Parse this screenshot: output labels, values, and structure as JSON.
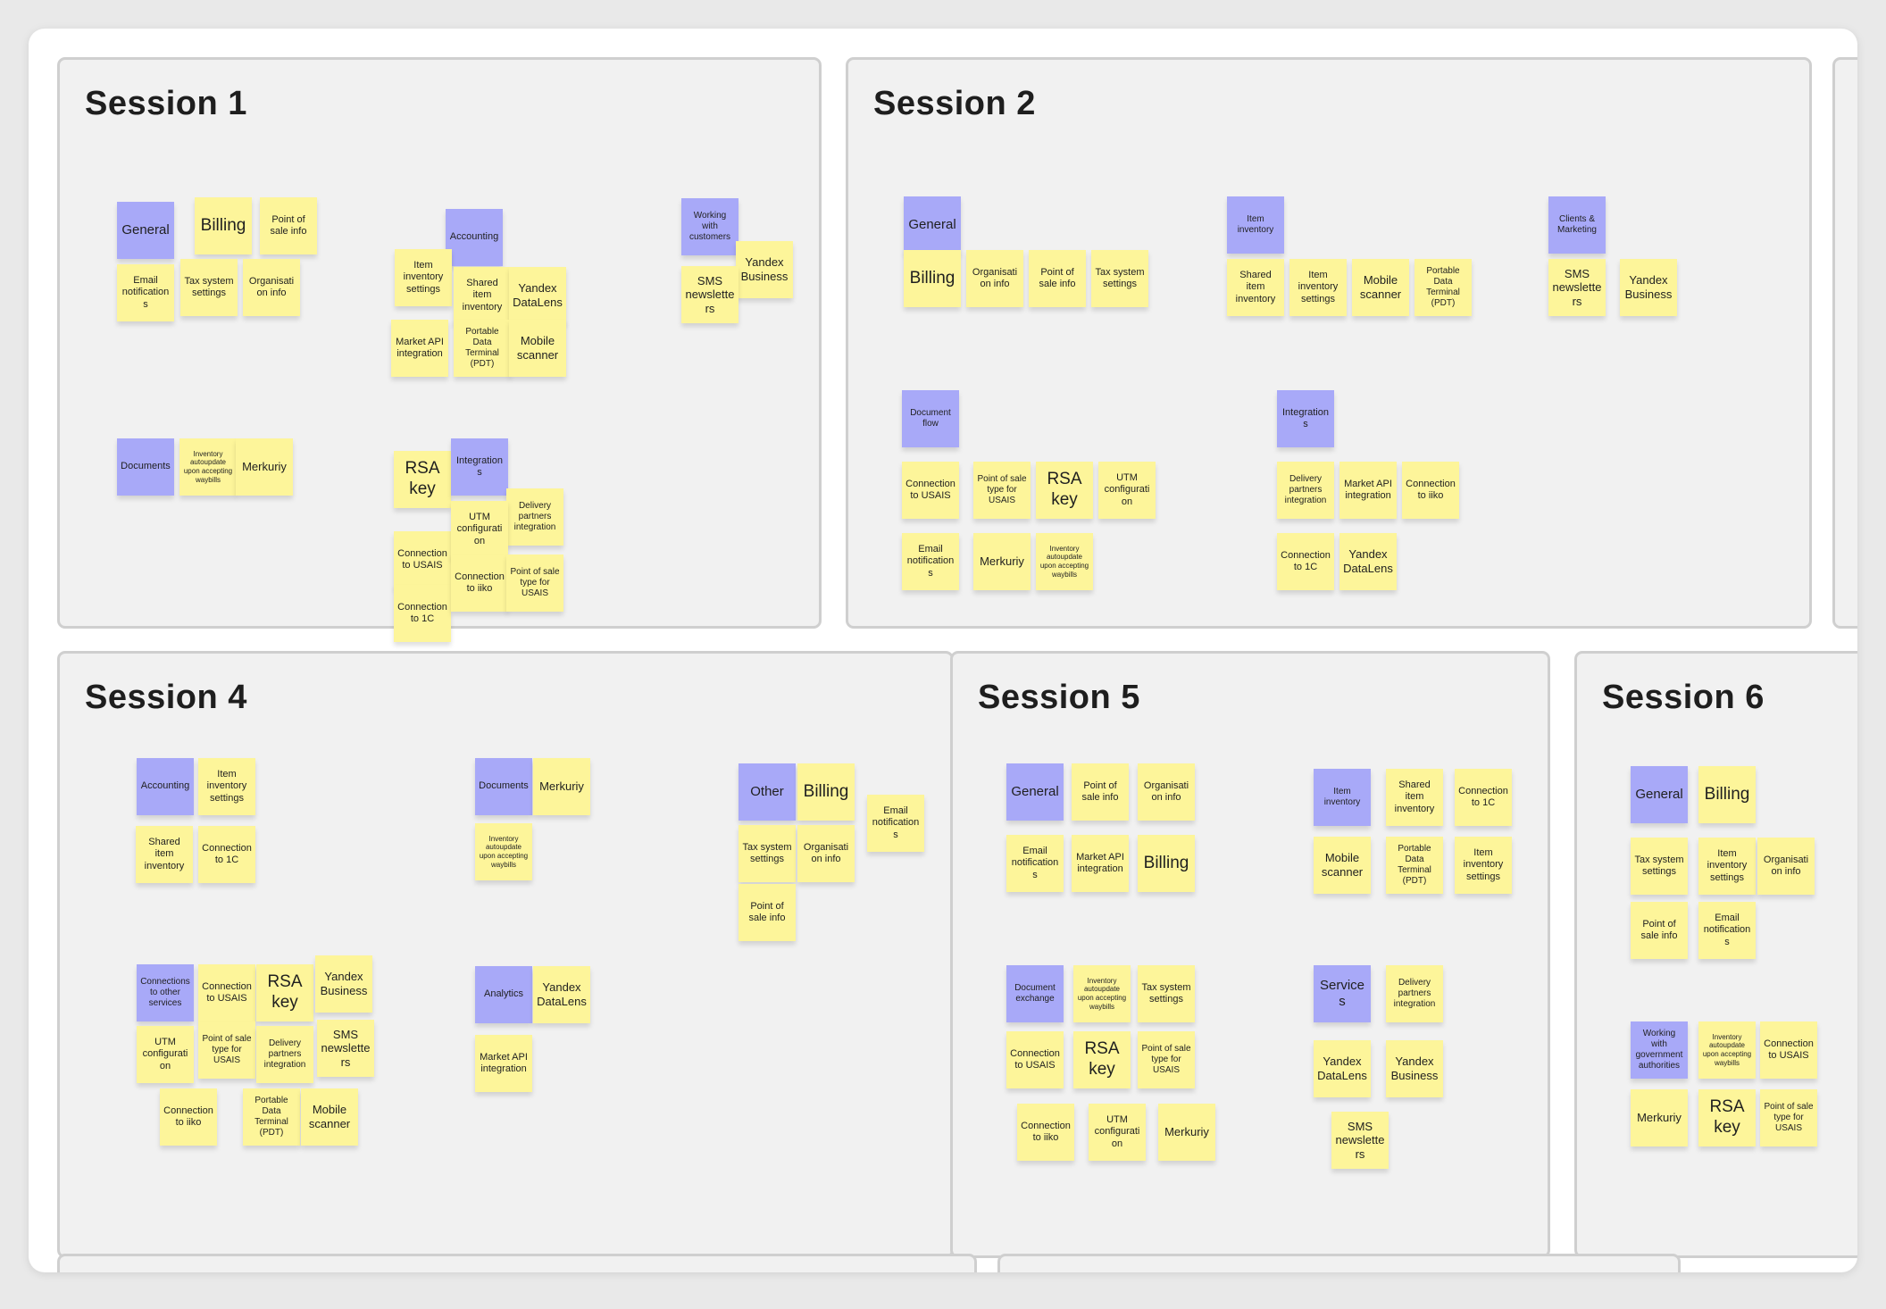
{
  "colors": {
    "category_note": "#a8a9f8",
    "item_note": "#fdf59a",
    "frame_bg": "#f1f1f1",
    "frame_border": "#cfcfcf"
  },
  "sessions": [
    {
      "title": "Session 1",
      "notes": [
        {
          "text": "General",
          "cat": true
        },
        {
          "text": "Billing"
        },
        {
          "text": "Point of sale info"
        },
        {
          "text": "Email notifications"
        },
        {
          "text": "Tax system settings"
        },
        {
          "text": "Organisation info"
        },
        {
          "text": "Accounting",
          "cat": true
        },
        {
          "text": "Item inventory settings"
        },
        {
          "text": "Shared item inventory"
        },
        {
          "text": "Yandex DataLens"
        },
        {
          "text": "Market API integration"
        },
        {
          "text": "Portable Data Terminal (PDT)"
        },
        {
          "text": "Mobile scanner"
        },
        {
          "text": "Working with customers",
          "cat": true
        },
        {
          "text": "Yandex Business"
        },
        {
          "text": "SMS newsletters"
        },
        {
          "text": "Documents",
          "cat": true
        },
        {
          "text": "Inventory autoupdate upon accepting waybills"
        },
        {
          "text": "Merkuriy"
        },
        {
          "text": "RSA key"
        },
        {
          "text": "Integrations",
          "cat": true
        },
        {
          "text": "Delivery partners integration"
        },
        {
          "text": "Connection to USAIS"
        },
        {
          "text": "UTM configuration"
        },
        {
          "text": "Connection to 1C"
        },
        {
          "text": "Connection to iiko"
        },
        {
          "text": "Point of sale type for USAIS"
        }
      ]
    },
    {
      "title": "Session 2",
      "notes": [
        {
          "text": "General",
          "cat": true
        },
        {
          "text": "Billing"
        },
        {
          "text": "Organisation info"
        },
        {
          "text": "Point of sale info"
        },
        {
          "text": "Tax system settings"
        },
        {
          "text": "Item inventory",
          "cat": true
        },
        {
          "text": "Shared item inventory"
        },
        {
          "text": "Item inventory settings"
        },
        {
          "text": "Mobile scanner"
        },
        {
          "text": "Portable Data Terminal (PDT)"
        },
        {
          "text": "Clients & Marketing",
          "cat": true
        },
        {
          "text": "SMS newsletters"
        },
        {
          "text": "Yandex Business"
        },
        {
          "text": "Document flow",
          "cat": true
        },
        {
          "text": "Connection to USAIS"
        },
        {
          "text": "Point of sale type for USAIS"
        },
        {
          "text": "RSA key"
        },
        {
          "text": "UTM configuration"
        },
        {
          "text": "Email notifications"
        },
        {
          "text": "Merkuriy"
        },
        {
          "text": "Inventory autoupdate upon accepting waybills"
        },
        {
          "text": "Integrations",
          "cat": true
        },
        {
          "text": "Delivery partners integration"
        },
        {
          "text": "Market API integration"
        },
        {
          "text": "Connection to iiko"
        },
        {
          "text": "Connection to 1C"
        },
        {
          "text": "Yandex DataLens"
        }
      ]
    },
    {
      "title": "Session 4",
      "notes": [
        {
          "text": "Accounting",
          "cat": true
        },
        {
          "text": "Item inventory settings"
        },
        {
          "text": "Shared item inventory"
        },
        {
          "text": "Connection to 1C"
        },
        {
          "text": "Documents",
          "cat": true
        },
        {
          "text": "Merkuriy"
        },
        {
          "text": "Inventory autoupdate upon accepting waybills"
        },
        {
          "text": "Other",
          "cat": true
        },
        {
          "text": "Billing"
        },
        {
          "text": "Email notifications"
        },
        {
          "text": "Tax system settings"
        },
        {
          "text": "Organisation info"
        },
        {
          "text": "Point of sale info"
        },
        {
          "text": "Connections to other services",
          "cat": true
        },
        {
          "text": "Connection to USAIS"
        },
        {
          "text": "RSA key"
        },
        {
          "text": "Yandex Business"
        },
        {
          "text": "SMS newsletters"
        },
        {
          "text": "UTM configuration"
        },
        {
          "text": "Point of sale type for USAIS"
        },
        {
          "text": "Delivery partners integration"
        },
        {
          "text": "Connection to iiko"
        },
        {
          "text": "Portable Data Terminal (PDT)"
        },
        {
          "text": "Mobile scanner"
        },
        {
          "text": "Analytics",
          "cat": true
        },
        {
          "text": "Yandex DataLens"
        },
        {
          "text": "Market API integration"
        }
      ]
    },
    {
      "title": "Session 5",
      "notes": [
        {
          "text": "General",
          "cat": true
        },
        {
          "text": "Point of sale info"
        },
        {
          "text": "Organisation info"
        },
        {
          "text": "Email notifications"
        },
        {
          "text": "Market API integration"
        },
        {
          "text": "Billing"
        },
        {
          "text": "Item inventory",
          "cat": true
        },
        {
          "text": "Shared item inventory"
        },
        {
          "text": "Connection to 1C"
        },
        {
          "text": "Mobile scanner"
        },
        {
          "text": "Portable Data Terminal (PDT)"
        },
        {
          "text": "Item inventory settings"
        },
        {
          "text": "Document exchange",
          "cat": true
        },
        {
          "text": "Inventory autoupdate upon accepting waybills"
        },
        {
          "text": "Tax system settings"
        },
        {
          "text": "Connection to USAIS"
        },
        {
          "text": "RSA key"
        },
        {
          "text": "Point of sale type for USAIS"
        },
        {
          "text": "Connection to iiko"
        },
        {
          "text": "UTM configuration"
        },
        {
          "text": "Merkuriy"
        },
        {
          "text": "Services",
          "cat": true
        },
        {
          "text": "Delivery partners integration"
        },
        {
          "text": "Yandex DataLens"
        },
        {
          "text": "Yandex Business"
        },
        {
          "text": "SMS newsletters"
        }
      ]
    },
    {
      "title": "Session 6",
      "notes": [
        {
          "text": "General",
          "cat": true
        },
        {
          "text": "Billing"
        },
        {
          "text": "Tax system settings"
        },
        {
          "text": "Item inventory settings"
        },
        {
          "text": "Organisation info"
        },
        {
          "text": "Point of sale info"
        },
        {
          "text": "Email notifications"
        },
        {
          "text": "Working with government authorities",
          "cat": true
        },
        {
          "text": "Inventory autoupdate upon accepting waybills"
        },
        {
          "text": "Connection to USAIS"
        },
        {
          "text": "Merkuriy"
        },
        {
          "text": "RSA key"
        },
        {
          "text": "Point of sale type for USAIS"
        }
      ]
    }
  ]
}
